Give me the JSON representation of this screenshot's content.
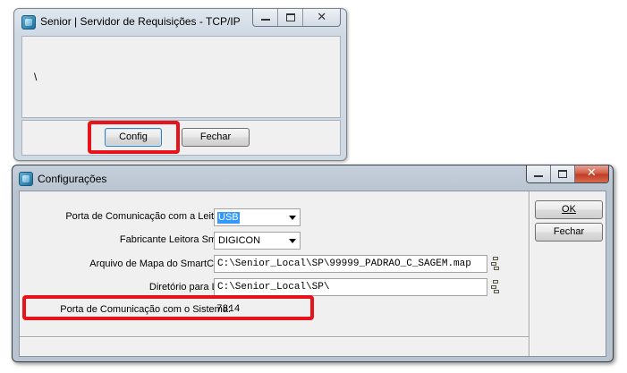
{
  "window1": {
    "title": "Senior | Servidor de Requisições - TCP/IP",
    "content_text": "\\",
    "config_button": "Config",
    "fechar_button": "Fechar",
    "icon": "app-icon"
  },
  "window2": {
    "title": "Configurações",
    "ok_button": "OK",
    "fechar_button": "Fechar",
    "fields": {
      "porta_leitora": {
        "label": "Porta de Comunicação com a Leitora:",
        "value": "USB"
      },
      "fabricante": {
        "label": "Fabricante Leitora Smart:",
        "value": "DIGICON"
      },
      "arquivo_mapa": {
        "label": "Arquivo de Mapa do SmartCard:",
        "value": "C:\\Senior_Local\\SP\\99999_PADRAO_C_SAGEM.map"
      },
      "diretorio_log": {
        "label": "Diretório para Log:",
        "value": "C:\\Senior_Local\\SP\\"
      },
      "porta_sistema": {
        "label": "Porta de Comunicação com o Sistema:",
        "value": "7814"
      }
    }
  },
  "colors": {
    "highlight": "#e8121b",
    "selection": "#3399ff",
    "close_button": "#c9452d"
  }
}
